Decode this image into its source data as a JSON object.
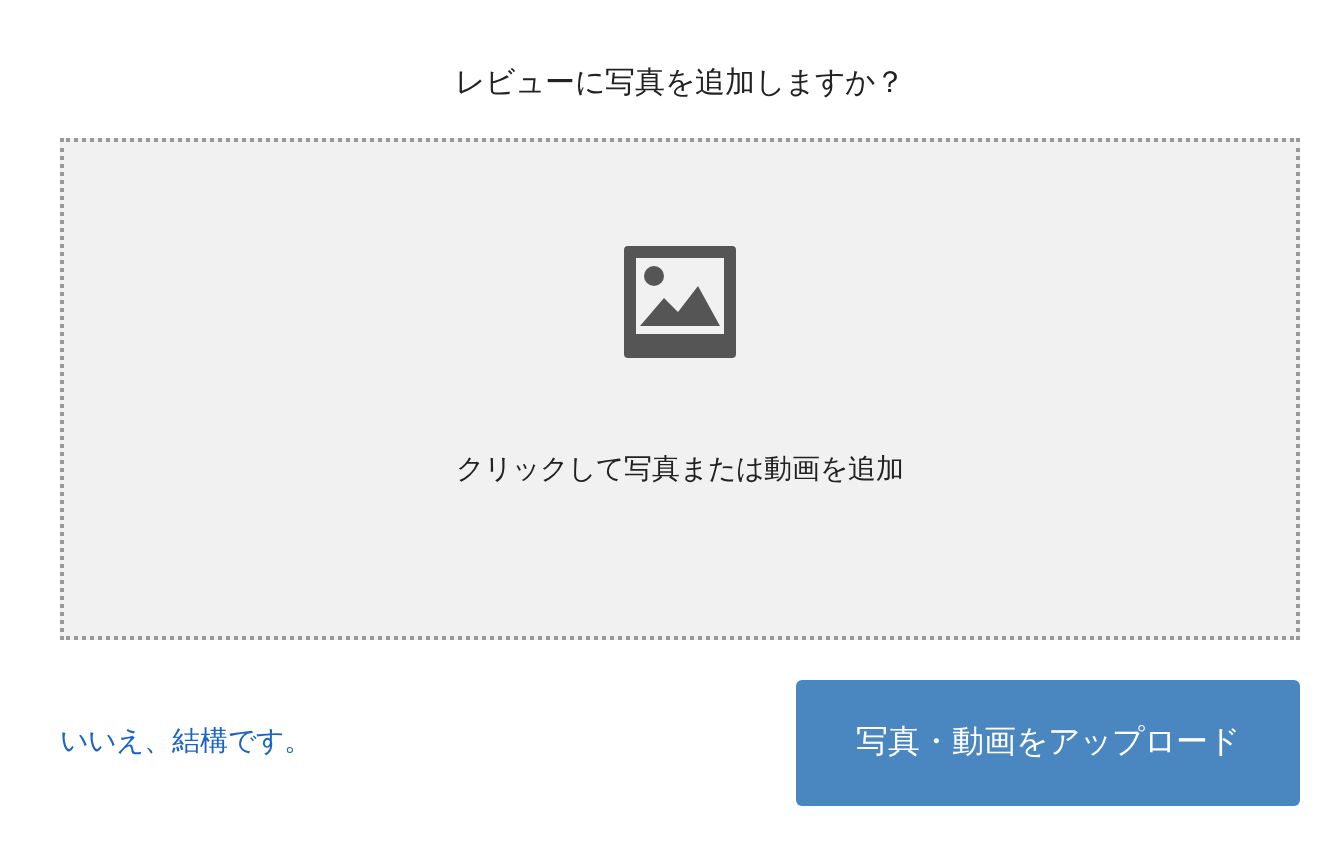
{
  "title": "レビューに写真を追加しますか？",
  "dropzone": {
    "label": "クリックして写真または動画を追加"
  },
  "decline_link": "いいえ、結構です。",
  "upload_button": "写真・動画をアップロード"
}
